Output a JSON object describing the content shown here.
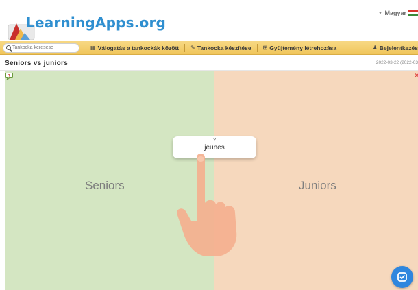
{
  "header": {
    "logo_text": "LearningApps.org",
    "language": "Magyar"
  },
  "nav": {
    "search_placeholder": "Tankocka keresése",
    "items": [
      {
        "label": "Válogatás a tankockák között",
        "icon": "grid-icon"
      },
      {
        "label": "Tankocka készítése",
        "icon": "pencil-icon"
      },
      {
        "label": "Gyűjtemény létrehozása",
        "icon": "collection-icon"
      },
      {
        "label": "Bejelentkezés",
        "icon": "user-icon"
      }
    ]
  },
  "app": {
    "title": "Seniors vs juniors",
    "date": "2022-03-22 (2022-03"
  },
  "game": {
    "left_label": "Seniors",
    "right_label": "Juniors",
    "card_hint": "?",
    "card_word": "jeunes",
    "left_color": "#d4e6c2",
    "right_color": "#f6d8bd",
    "check_color": "#2e86de"
  }
}
